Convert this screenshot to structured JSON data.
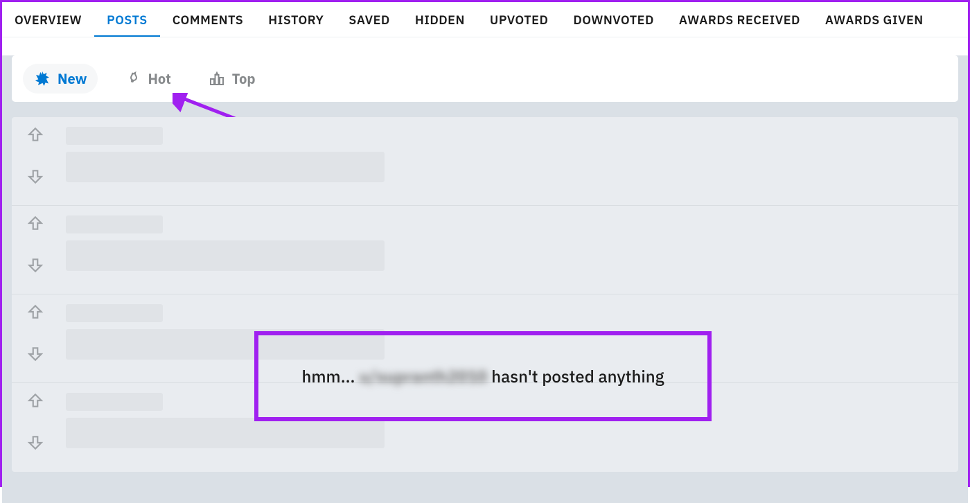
{
  "tabs": [
    {
      "label": "OVERVIEW"
    },
    {
      "label": "POSTS"
    },
    {
      "label": "COMMENTS"
    },
    {
      "label": "HISTORY"
    },
    {
      "label": "SAVED"
    },
    {
      "label": "HIDDEN"
    },
    {
      "label": "UPVOTED"
    },
    {
      "label": "DOWNVOTED"
    },
    {
      "label": "AWARDS RECEIVED"
    },
    {
      "label": "AWARDS GIVEN"
    }
  ],
  "activeTab": "POSTS",
  "sort": {
    "new": "New",
    "hot": "Hot",
    "top": "Top",
    "active": "new"
  },
  "empty": {
    "prefix": "hmm... ",
    "username": "u/supranth2010",
    "suffix": " hasn't posted anything"
  },
  "accent": "#a020f0"
}
